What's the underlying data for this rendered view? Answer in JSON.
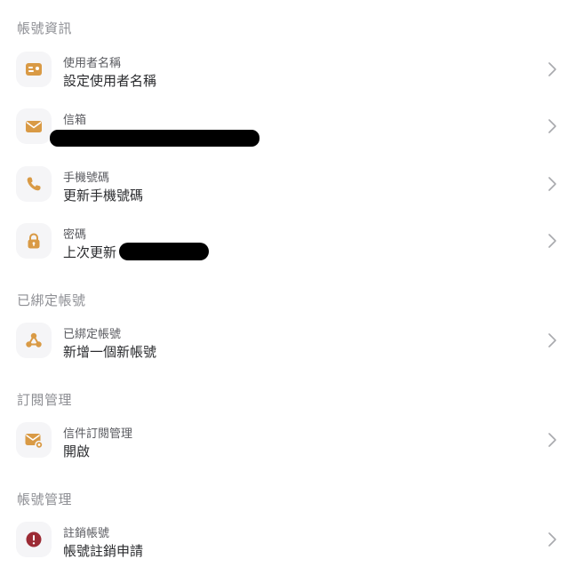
{
  "colors": {
    "accent": "#d99a45",
    "danger": "#9c2b35",
    "section_text": "#8e8f94",
    "chevron": "#a8a9ad"
  },
  "sections": {
    "account_info": "帳號資訊",
    "linked_accounts": "已綁定帳號",
    "subscription": "訂閱管理",
    "account_management": "帳號管理"
  },
  "rows": {
    "username": {
      "label": "使用者名稱",
      "value": "設定使用者名稱",
      "icon": "id-card-icon"
    },
    "email": {
      "label": "信箱",
      "value": "",
      "icon": "envelope-icon"
    },
    "phone": {
      "label": "手機號碼",
      "value": "更新手機號碼",
      "icon": "phone-icon"
    },
    "password": {
      "label": "密碼",
      "value": "上次更新",
      "icon": "lock-icon"
    },
    "linked": {
      "label": "已綁定帳號",
      "value": "新增一個新帳號",
      "icon": "share-nodes-icon"
    },
    "newsletter": {
      "label": "信件訂閱管理",
      "value": "開啟",
      "icon": "envelope-badge-icon"
    },
    "delete": {
      "label": "註銷帳號",
      "value": "帳號註銷申請",
      "icon": "alert-circle-icon"
    }
  }
}
